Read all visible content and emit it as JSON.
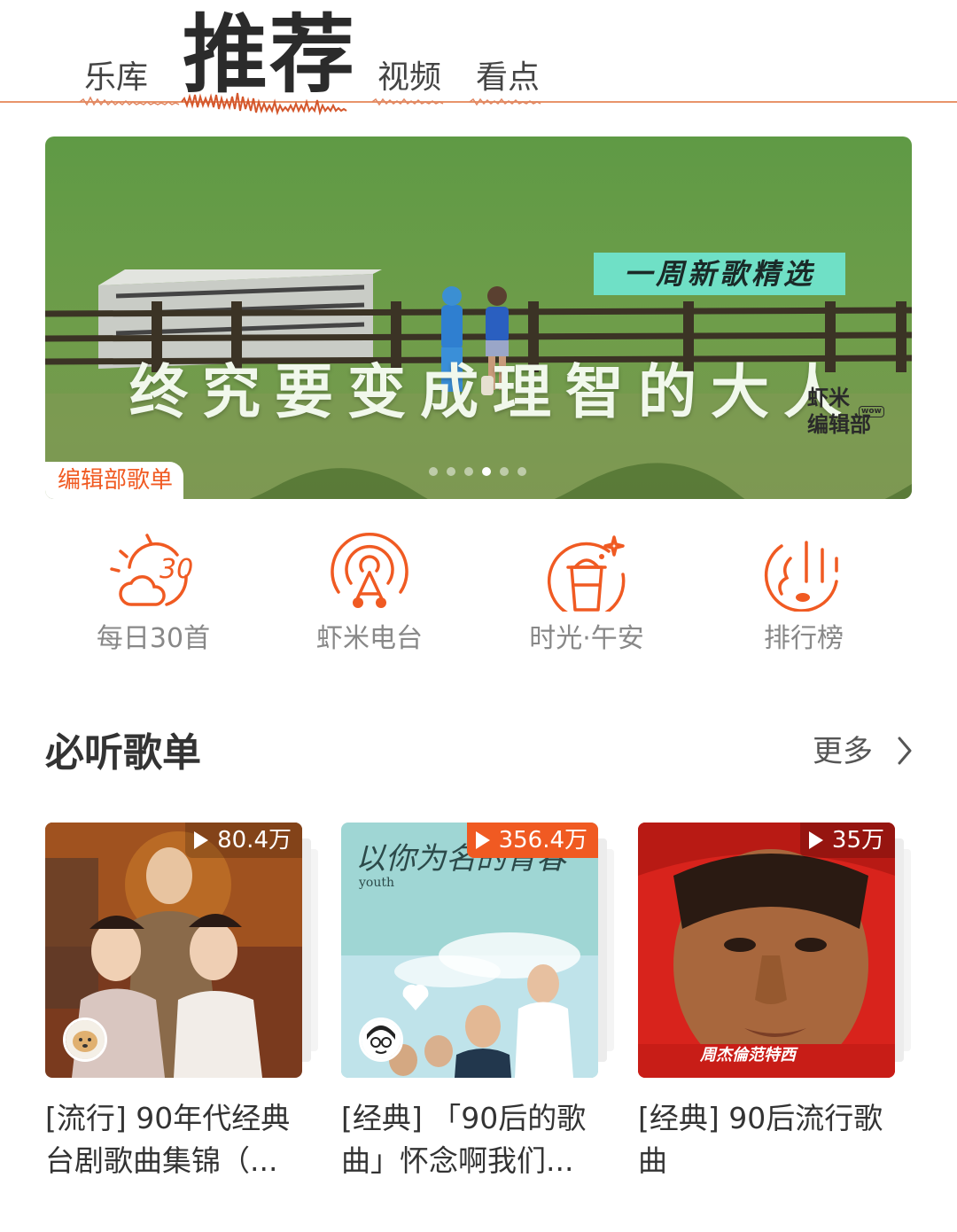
{
  "tabs": [
    {
      "label": "乐库",
      "active": false
    },
    {
      "label": "推荐",
      "active": true
    },
    {
      "label": "视频",
      "active": false
    },
    {
      "label": "看点",
      "active": false
    }
  ],
  "banner": {
    "title": "终究要变成理智的大人",
    "subtitle": "一周新歌精选",
    "brand_line1": "虾米",
    "brand_line2": "编辑部",
    "brand_badge": "wow",
    "tag": "编辑部歌单",
    "dots_total": 6,
    "dots_active": 4
  },
  "entries": [
    {
      "label": "每日30首",
      "icon": "daily-30-weather-icon",
      "icon_text": "30"
    },
    {
      "label": "虾米电台",
      "icon": "radio-icon"
    },
    {
      "label": "时光·午安",
      "icon": "coffee-cup-icon"
    },
    {
      "label": "排行榜",
      "icon": "chart-rank-icon"
    }
  ],
  "section": {
    "title": "必听歌单",
    "more_label": "更多"
  },
  "playlists": [
    {
      "plays": "80.4万",
      "hot": false,
      "title": "[流行] 90年代经典台剧歌曲集锦（...",
      "cover_text": ""
    },
    {
      "plays": "356.4万",
      "hot": true,
      "title": "[经典] 「90后的歌曲」怀念啊我们...",
      "cover_text": "以你为名的青春",
      "cover_small": "youth"
    },
    {
      "plays": "35万",
      "hot": false,
      "title": "[经典] 90后流行歌曲",
      "cover_text": "周杰倫范特西"
    }
  ],
  "colors": {
    "accent": "#f05a22",
    "banner_sub_bg": "#6fe0c6",
    "text_primary": "#333333",
    "text_secondary": "#888888"
  }
}
